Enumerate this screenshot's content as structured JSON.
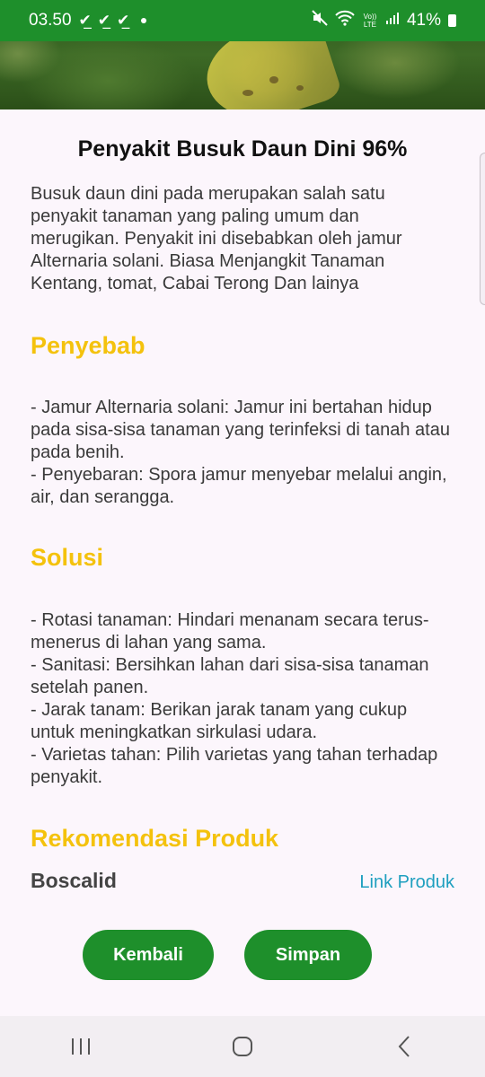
{
  "status_bar": {
    "time": "03.50",
    "battery": "41%",
    "volte": "Vo)) LTE"
  },
  "disease": {
    "title": "Penyakit Busuk Daun Dini 96%",
    "description": "Busuk daun dini pada merupakan salah satu penyakit tanaman yang paling umum dan merugikan. Penyakit ini disebabkan oleh jamur Alternaria solani. Biasa Menjangkit Tanaman Kentang, tomat, Cabai Terong Dan lainya"
  },
  "cause": {
    "heading": "Penyebab",
    "lines": [
      " - Jamur Alternaria solani: Jamur ini bertahan hidup pada sisa-sisa tanaman yang terinfeksi di tanah atau pada benih.",
      " - Penyebaran: Spora jamur menyebar melalui angin, air, dan serangga."
    ]
  },
  "solution": {
    "heading": "Solusi",
    "lines": [
      " - Rotasi tanaman: Hindari menanam secara terus-menerus di lahan yang sama.",
      " - Sanitasi: Bersihkan lahan dari sisa-sisa tanaman setelah panen.",
      " - Jarak tanam: Berikan jarak tanam yang cukup untuk meningkatkan sirkulasi udara.",
      " - Varietas tahan: Pilih varietas yang tahan terhadap penyakit."
    ]
  },
  "recommendation": {
    "heading": "Rekomendasi Produk",
    "product_name": "Boscalid",
    "link_label": "Link Produk"
  },
  "buttons": {
    "back_label": "Kembali",
    "save_label": "Simpan"
  },
  "colors": {
    "primary_green": "#1e8f2b",
    "heading_yellow": "#f4c20d",
    "link_blue": "#1e9fbf"
  }
}
